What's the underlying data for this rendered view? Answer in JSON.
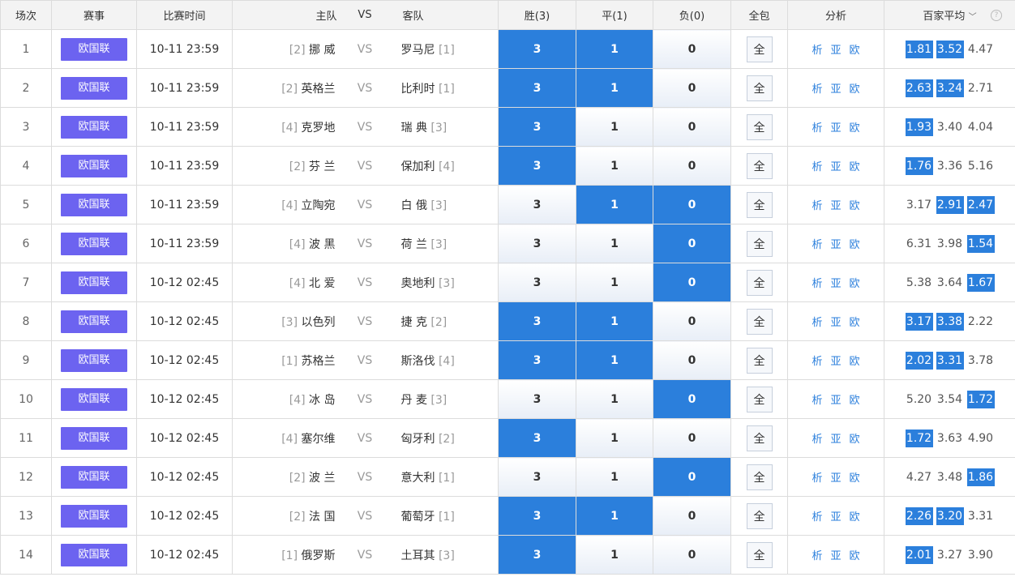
{
  "header": {
    "index": "场次",
    "league": "赛事",
    "time": "比赛时间",
    "home": "主队",
    "vs": "VS",
    "away": "客队",
    "win": "胜(3)",
    "draw": "平(1)",
    "lose": "负(0)",
    "full": "全包",
    "analysis": "分析",
    "odds_avg": "百家平均",
    "caret": "﹀",
    "help": "?"
  },
  "labels": {
    "win_value": "3",
    "draw_value": "1",
    "lose_value": "0",
    "full_button": "全",
    "analysis_xi": "析",
    "analysis_ya": "亚",
    "analysis_ou": "欧",
    "vs": "VS"
  },
  "colors": {
    "accent": "#2b7fdc",
    "league_badge": "#6c63f0"
  },
  "matches": [
    {
      "index": "1",
      "league": "欧国联",
      "time": "10-11 23:59",
      "home_rank": "[2]",
      "home": "挪 威",
      "away": "罗马尼",
      "away_rank": "[1]",
      "sel": [
        true,
        true,
        false
      ],
      "odds": [
        "1.81",
        "3.52",
        "4.47"
      ],
      "odds_hl": [
        true,
        true,
        false
      ]
    },
    {
      "index": "2",
      "league": "欧国联",
      "time": "10-11 23:59",
      "home_rank": "[2]",
      "home": "英格兰",
      "away": "比利时",
      "away_rank": "[1]",
      "sel": [
        true,
        true,
        false
      ],
      "odds": [
        "2.63",
        "3.24",
        "2.71"
      ],
      "odds_hl": [
        true,
        true,
        false
      ]
    },
    {
      "index": "3",
      "league": "欧国联",
      "time": "10-11 23:59",
      "home_rank": "[4]",
      "home": "克罗地",
      "away": "瑞 典",
      "away_rank": "[3]",
      "sel": [
        true,
        false,
        false
      ],
      "odds": [
        "1.93",
        "3.40",
        "4.04"
      ],
      "odds_hl": [
        true,
        false,
        false
      ]
    },
    {
      "index": "4",
      "league": "欧国联",
      "time": "10-11 23:59",
      "home_rank": "[2]",
      "home": "芬 兰",
      "away": "保加利",
      "away_rank": "[4]",
      "sel": [
        true,
        false,
        false
      ],
      "odds": [
        "1.76",
        "3.36",
        "5.16"
      ],
      "odds_hl": [
        true,
        false,
        false
      ]
    },
    {
      "index": "5",
      "league": "欧国联",
      "time": "10-11 23:59",
      "home_rank": "[4]",
      "home": "立陶宛",
      "away": "白 俄",
      "away_rank": "[3]",
      "sel": [
        false,
        true,
        true
      ],
      "odds": [
        "3.17",
        "2.91",
        "2.47"
      ],
      "odds_hl": [
        false,
        true,
        true
      ]
    },
    {
      "index": "6",
      "league": "欧国联",
      "time": "10-11 23:59",
      "home_rank": "[4]",
      "home": "波 黑",
      "away": "荷 兰",
      "away_rank": "[3]",
      "sel": [
        false,
        false,
        true
      ],
      "odds": [
        "6.31",
        "3.98",
        "1.54"
      ],
      "odds_hl": [
        false,
        false,
        true
      ]
    },
    {
      "index": "7",
      "league": "欧国联",
      "time": "10-12 02:45",
      "home_rank": "[4]",
      "home": "北 爱",
      "away": "奥地利",
      "away_rank": "[3]",
      "sel": [
        false,
        false,
        true
      ],
      "odds": [
        "5.38",
        "3.64",
        "1.67"
      ],
      "odds_hl": [
        false,
        false,
        true
      ]
    },
    {
      "index": "8",
      "league": "欧国联",
      "time": "10-12 02:45",
      "home_rank": "[3]",
      "home": "以色列",
      "away": "捷 克",
      "away_rank": "[2]",
      "sel": [
        true,
        true,
        false
      ],
      "odds": [
        "3.17",
        "3.38",
        "2.22"
      ],
      "odds_hl": [
        true,
        true,
        false
      ]
    },
    {
      "index": "9",
      "league": "欧国联",
      "time": "10-12 02:45",
      "home_rank": "[1]",
      "home": "苏格兰",
      "away": "斯洛伐",
      "away_rank": "[4]",
      "sel": [
        true,
        true,
        false
      ],
      "odds": [
        "2.02",
        "3.31",
        "3.78"
      ],
      "odds_hl": [
        true,
        true,
        false
      ]
    },
    {
      "index": "10",
      "league": "欧国联",
      "time": "10-12 02:45",
      "home_rank": "[4]",
      "home": "冰 岛",
      "away": "丹 麦",
      "away_rank": "[3]",
      "sel": [
        false,
        false,
        true
      ],
      "odds": [
        "5.20",
        "3.54",
        "1.72"
      ],
      "odds_hl": [
        false,
        false,
        true
      ]
    },
    {
      "index": "11",
      "league": "欧国联",
      "time": "10-12 02:45",
      "home_rank": "[4]",
      "home": "塞尔维",
      "away": "匈牙利",
      "away_rank": "[2]",
      "sel": [
        true,
        false,
        false
      ],
      "odds": [
        "1.72",
        "3.63",
        "4.90"
      ],
      "odds_hl": [
        true,
        false,
        false
      ]
    },
    {
      "index": "12",
      "league": "欧国联",
      "time": "10-12 02:45",
      "home_rank": "[2]",
      "home": "波 兰",
      "away": "意大利",
      "away_rank": "[1]",
      "sel": [
        false,
        false,
        true
      ],
      "odds": [
        "4.27",
        "3.48",
        "1.86"
      ],
      "odds_hl": [
        false,
        false,
        true
      ]
    },
    {
      "index": "13",
      "league": "欧国联",
      "time": "10-12 02:45",
      "home_rank": "[2]",
      "home": "法 国",
      "away": "葡萄牙",
      "away_rank": "[1]",
      "sel": [
        true,
        true,
        false
      ],
      "odds": [
        "2.26",
        "3.20",
        "3.31"
      ],
      "odds_hl": [
        true,
        true,
        false
      ]
    },
    {
      "index": "14",
      "league": "欧国联",
      "time": "10-12 02:45",
      "home_rank": "[1]",
      "home": "俄罗斯",
      "away": "土耳其",
      "away_rank": "[3]",
      "sel": [
        true,
        false,
        false
      ],
      "odds": [
        "2.01",
        "3.27",
        "3.90"
      ],
      "odds_hl": [
        true,
        false,
        false
      ]
    }
  ]
}
